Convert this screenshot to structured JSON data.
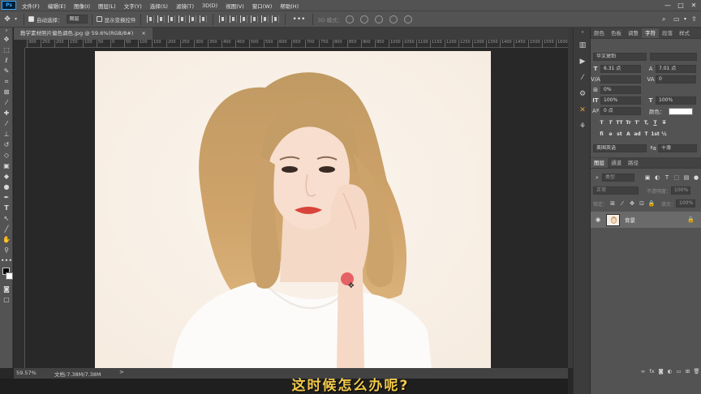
{
  "menubar": {
    "logo": "Ps",
    "items": [
      "文件(F)",
      "编辑(E)",
      "图像(I)",
      "图层(L)",
      "文字(Y)",
      "选择(S)",
      "滤镜(T)",
      "3D(D)",
      "视图(V)",
      "窗口(W)",
      "帮助(H)"
    ],
    "window_controls": [
      "—",
      "□",
      "✕"
    ]
  },
  "optionsbar": {
    "auto_select_label": "自动选择：",
    "auto_select_value": "图层",
    "transform_label": "显示变换控件",
    "mode_3d_label": "3D 模式："
  },
  "document": {
    "tab_title": "教学素材照片偏色调色.jpg @ 59.6%(RGB/8#)",
    "tab_close": "×",
    "ruler_ticks": [
      "300",
      "250",
      "200",
      "150",
      "100",
      "50",
      "0",
      "50",
      "100",
      "150",
      "200",
      "250",
      "300",
      "350",
      "400",
      "450",
      "500",
      "550",
      "600",
      "650",
      "700",
      "750",
      "800",
      "850",
      "900",
      "950",
      "1000",
      "1050",
      "1100",
      "1150",
      "1200",
      "1250",
      "1300",
      "1350",
      "1400",
      "1450",
      "1500",
      "1550",
      "1600"
    ]
  },
  "statusbar": {
    "zoom": "59.57%",
    "doc_info": "文档:7.38M/7.38M",
    "arrow": ">"
  },
  "character_panel": {
    "tabs": [
      "颜色",
      "色板",
      "调整",
      "字符",
      "段落",
      "样式"
    ],
    "active_tab": "字符",
    "font_family": "华文琥珀",
    "font_size": "6.31 点",
    "leading": "7.01 点",
    "kerning": "",
    "tracking": "0",
    "vertical_scale": "100%",
    "horizontal_scale": "100%",
    "baseline_shift": "0 点",
    "color_label": "颜色：",
    "tsume": "0%",
    "style_buttons": [
      "T",
      "T",
      "TT",
      "Tr",
      "T'",
      "T,",
      "T",
      "T"
    ],
    "language": "美国英语",
    "antialias": "十滑"
  },
  "layers_panel": {
    "tabs": [
      "图层",
      "通道",
      "路径"
    ],
    "active_tab": "图层",
    "filter_label": "类型",
    "blend_mode": "正常",
    "opacity_label": "不透明度：",
    "opacity_value": "100%",
    "lock_label": "锁定：",
    "fill_label": "填充：",
    "fill_value": "100%",
    "layers": [
      {
        "name": "背景",
        "visible": true,
        "locked": true
      }
    ],
    "footer_icons": [
      "link-icon",
      "fx-icon",
      "mask-icon",
      "adjustment-icon",
      "group-icon",
      "new-layer-icon",
      "delete-icon"
    ]
  },
  "subtitle": "这时候怎么办呢?",
  "colors": {
    "panel_bg": "#535353",
    "canvas_bg": "#282828",
    "subtitle": "#f2c94c"
  }
}
